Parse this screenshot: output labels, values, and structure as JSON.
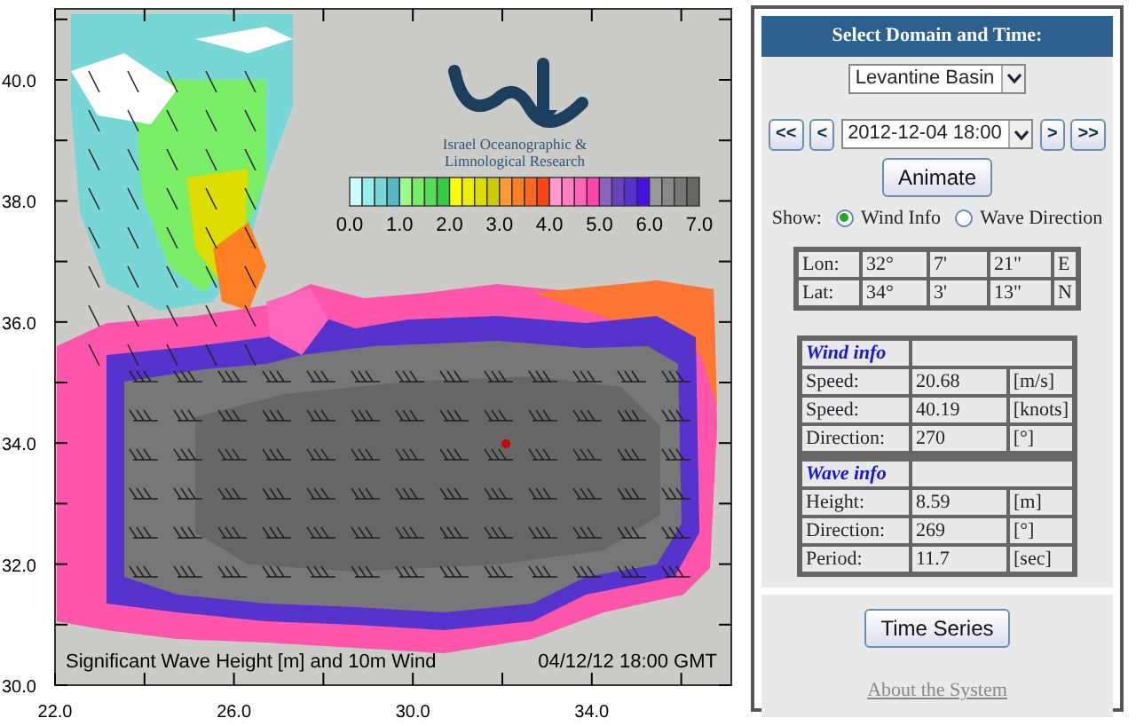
{
  "map": {
    "y_ticks": [
      "40.0",
      "38.0",
      "36.0",
      "34.0",
      "32.0",
      "30.0"
    ],
    "x_ticks": [
      "22.0",
      "26.0",
      "30.0",
      "34.0"
    ],
    "logo_text": [
      "Israel Oceanographic &",
      "Limnological Research"
    ],
    "colorbar": {
      "swatches": [
        {
          "color": "#ccffff"
        },
        {
          "color": "#99eeee"
        },
        {
          "color": "#77d6d6"
        },
        {
          "color": "#55b8c8"
        },
        {
          "color": "#99ff88"
        },
        {
          "color": "#77ee66"
        },
        {
          "color": "#55dd55"
        },
        {
          "color": "#33cc44"
        },
        {
          "color": "#ffff00"
        },
        {
          "color": "#eeee00"
        },
        {
          "color": "#dddd00"
        },
        {
          "color": "#cccc00"
        },
        {
          "color": "#ff9933"
        },
        {
          "color": "#ff8022"
        },
        {
          "color": "#ff6622"
        },
        {
          "color": "#ff4411"
        },
        {
          "color": "#ff99cc"
        },
        {
          "color": "#ff80c0"
        },
        {
          "color": "#ff66bb"
        },
        {
          "color": "#ff44aa"
        },
        {
          "color": "#8866bb"
        },
        {
          "color": "#6644bb"
        },
        {
          "color": "#5533cc"
        },
        {
          "color": "#4411dd"
        },
        {
          "color": "#999999"
        },
        {
          "color": "#888888"
        },
        {
          "color": "#777777"
        },
        {
          "color": "#666666"
        }
      ],
      "labels": [
        "0.0",
        "1.0",
        "2.0",
        "3.0",
        "4.0",
        "5.0",
        "6.0",
        "7.0"
      ]
    },
    "caption": "Significant Wave Height [m] and 10m Wind",
    "timestamp": "04/12/12 18:00 GMT"
  },
  "panel": {
    "title": "Select Domain and Time:",
    "domain": "Levantine Basin",
    "prev_buttons": [
      "<<",
      "<"
    ],
    "time": "2012-12-04 18:00",
    "next_buttons": [
      ">",
      ">>"
    ],
    "animate_button": "Animate",
    "show_label": "Show:",
    "show_options": [
      {
        "label": "Wind Info",
        "selected": true
      },
      {
        "label": "Wave Direction",
        "selected": false
      }
    ],
    "position": [
      {
        "label": "Lon:",
        "degrees": "32°",
        "minutes": "7'",
        "seconds": "21\"",
        "hemisphere": "E"
      },
      {
        "label": "Lat:",
        "degrees": "34°",
        "minutes": "3'",
        "seconds": "13\"",
        "hemisphere": "N"
      }
    ],
    "wind_info": {
      "title": "Wind info",
      "rows": [
        {
          "label": "Speed:",
          "value": "20.68",
          "unit": "[m/s]"
        },
        {
          "label": "Speed:",
          "value": "40.19",
          "unit": "[knots]"
        },
        {
          "label": "Direction:",
          "value": "270",
          "unit": "[°]"
        }
      ]
    },
    "wave_info": {
      "title": "Wave info",
      "rows": [
        {
          "label": "Height:",
          "value": "8.59",
          "unit": "[m]"
        },
        {
          "label": "Direction:",
          "value": "269",
          "unit": "[°]"
        },
        {
          "label": "Period:",
          "value": "11.7",
          "unit": "[sec]"
        }
      ]
    },
    "time_series_button": "Time Series",
    "about_link": "About the System"
  }
}
